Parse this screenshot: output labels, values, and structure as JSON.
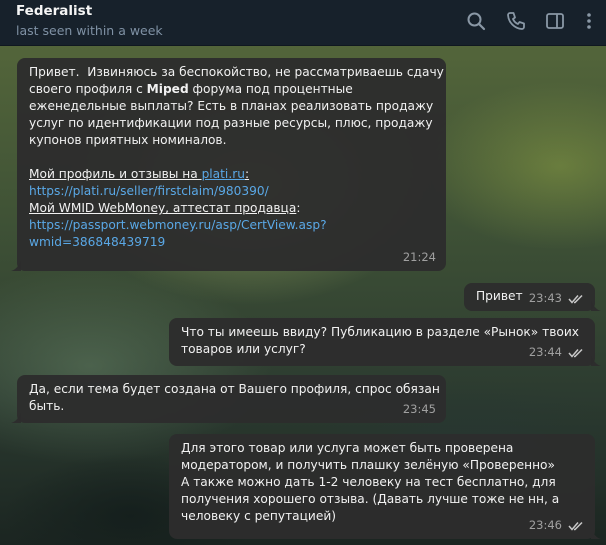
{
  "header": {
    "title": "Federalist",
    "status": "last seen within a week",
    "icons": [
      "search-icon",
      "phone-icon",
      "sidebar-toggle-icon",
      "more-vertical-icon"
    ]
  },
  "colors": {
    "header_bg": "#17212b",
    "bubble_bg": "#2d2d2d",
    "link": "#5aa8e6",
    "status_text": "#7f91a4",
    "time_text": "#a0a0a0"
  },
  "messages": [
    {
      "direction": "incoming",
      "lines": [
        "Привет.  Извиняюсь за беспокойство, не рассматриваешь сдачу",
        "своего профиля с ",
        "Miped",
        " форума под процентные",
        "еженедельные выплаты? Есть в планах реализовать продажу",
        "услуг по идентификации под разные ресурсы, плюс, продажу",
        "купонов приятных номиналов."
      ],
      "profile_label": "Мой профиль и отзывы на ",
      "profile_site": "plati.ru",
      "profile_colon": ":",
      "profile_url": "https://plati.ru/seller/firstclaim/980390/",
      "wmid_label": "Мой WMID WebMoney, аттестат продавца",
      "wmid_colon": ":",
      "wmid_url_1": "https://passport.webmoney.ru/asp/CertView.asp?",
      "wmid_url_2": "wmid=386848439719",
      "time": "21:24"
    },
    {
      "direction": "outgoing",
      "text": "Привет",
      "time": "23:43",
      "read": true
    },
    {
      "direction": "outgoing",
      "lines": [
        "Что ты имеешь ввиду? Публикацию в разделе «Рынок» твоих",
        "товаров или услуг?"
      ],
      "time": "23:44",
      "read": true
    },
    {
      "direction": "incoming",
      "lines": [
        "Да, если тема будет создана от Вашего профиля, спрос обязан",
        "быть."
      ],
      "time": "23:45"
    },
    {
      "direction": "outgoing",
      "lines": [
        "Для этого товар или услуга может быть проверена",
        "модератором, и получить плашку зелёную «Проверенно»",
        "А также можно дать 1-2 человеку на тест бесплатно, для",
        "получения хорошего отзыва. (Давать лучше тоже не нн, а",
        "человеку с репутацией)"
      ],
      "time": "23:46",
      "read": true
    }
  ]
}
